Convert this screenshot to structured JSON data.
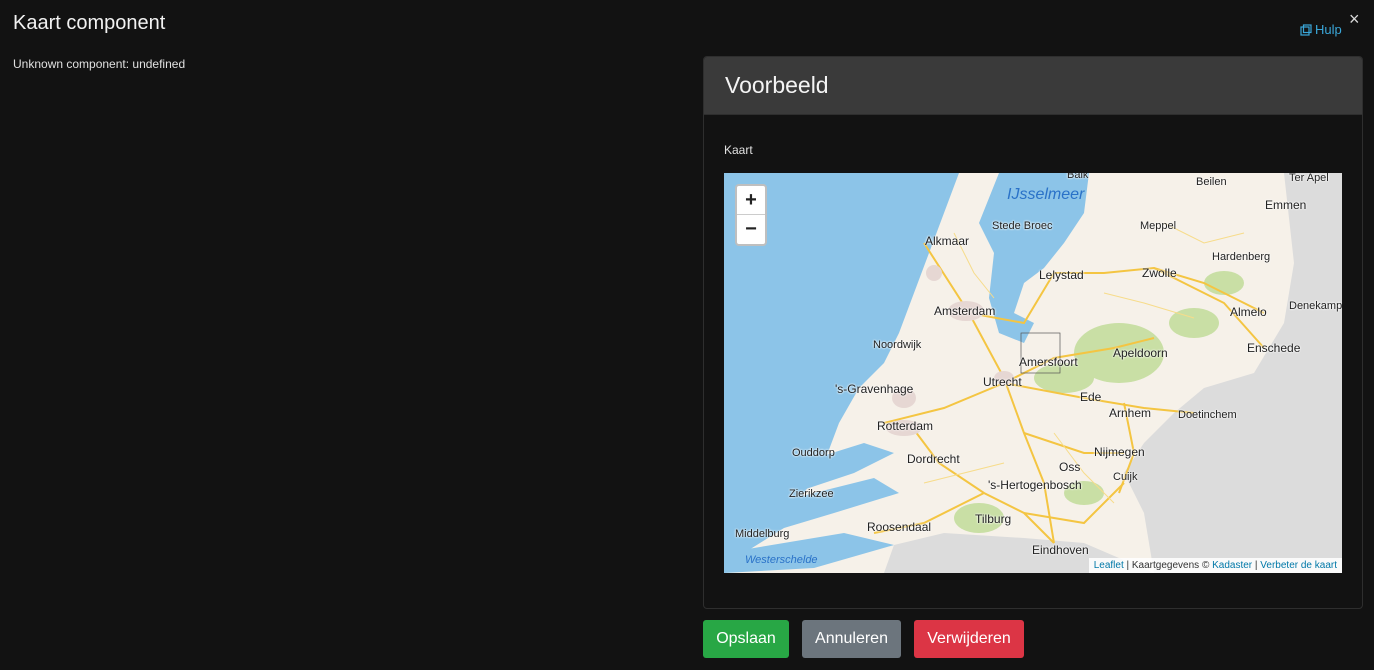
{
  "modal": {
    "title": "Kaart component",
    "help_label": "Hulp",
    "close_symbol": "×",
    "unknown_text": "Unknown component: undefined"
  },
  "preview": {
    "header": "Voorbeeld",
    "field_label": "Kaart"
  },
  "map": {
    "zoom_in": "+",
    "zoom_out": "−",
    "places": {
      "balk": "Balk",
      "beilen": "Beilen",
      "ter_apel": "Ter Apel",
      "emmen": "Emmen",
      "ijsselmeer": "IJsselmeer",
      "stede_broec": "Stede Broec",
      "meppel": "Meppel",
      "alkmaar": "Alkmaar",
      "hardenberg": "Hardenberg",
      "lelystad": "Lelystad",
      "zwolle": "Zwolle",
      "denekamp": "Denekamp",
      "amsterdam": "Amsterdam",
      "almelo": "Almelo",
      "noordwijk": "Noordwijk",
      "apeldoorn": "Apeldoorn",
      "enschede": "Enschede",
      "amersfoort": "Amersfoort",
      "utrecht": "Utrecht",
      "s_gravenhage": "'s-Gravenhage",
      "ede": "Ede",
      "arnhem": "Arnhem",
      "doetinchem": "Doetinchem",
      "rotterdam": "Rotterdam",
      "nijmegen": "Nijmegen",
      "ouddorp": "Ouddorp",
      "dordrecht": "Dordrecht",
      "oss": "Oss",
      "cuijk": "Cuijk",
      "s_hertogenbosch": "'s-Hertogenbosch",
      "zierikzee": "Zierikzee",
      "roosendaal": "Roosendaal",
      "tilburg": "Tilburg",
      "middelburg": "Middelburg",
      "eindhoven": "Eindhoven",
      "westerschelde": "Westerschelde"
    },
    "attribution": {
      "leaflet": "Leaflet",
      "sep1": " | Kaartgegevens © ",
      "kadaster": "Kadaster",
      "sep2": " | ",
      "improve": "Verbeter de kaart"
    }
  },
  "buttons": {
    "save": "Opslaan",
    "cancel": "Annuleren",
    "delete": "Verwijderen"
  },
  "colors": {
    "save": "#28a745",
    "cancel": "#6c757d",
    "delete": "#dc3545",
    "link": "#3aa7d9",
    "water": "#8cc4e8",
    "land": "#f6f1e9",
    "forest": "#c9dfa5",
    "road": "#f4c542"
  }
}
